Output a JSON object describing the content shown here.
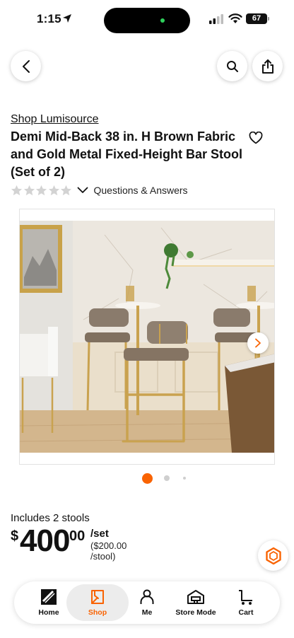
{
  "status_bar": {
    "time": "1:15",
    "battery": "67"
  },
  "product": {
    "brand": "Shop Lumisource",
    "title": "Demi Mid-Back 38 in. H Brown Fabric and Gold Metal Fixed-Height Bar Stool (Set of 2)",
    "rating_stars": 0,
    "qa_label": "Questions & Answers"
  },
  "gallery": {
    "active_index": 0,
    "dot_count": 3
  },
  "price": {
    "includes": "Includes 2 stools",
    "currency": "$",
    "dollars": "400",
    "cents": "00",
    "unit": "/set",
    "per_item": "($200.00 /stool)"
  },
  "tabs": [
    {
      "label": "Home",
      "icon": "home-depot-logo-icon"
    },
    {
      "label": "Shop",
      "icon": "shop-icon",
      "active": true
    },
    {
      "label": "Me",
      "icon": "person-icon"
    },
    {
      "label": "Store Mode",
      "icon": "store-icon"
    },
    {
      "label": "Cart",
      "icon": "cart-icon"
    }
  ],
  "colors": {
    "accent": "#f96302",
    "text": "#111111"
  }
}
